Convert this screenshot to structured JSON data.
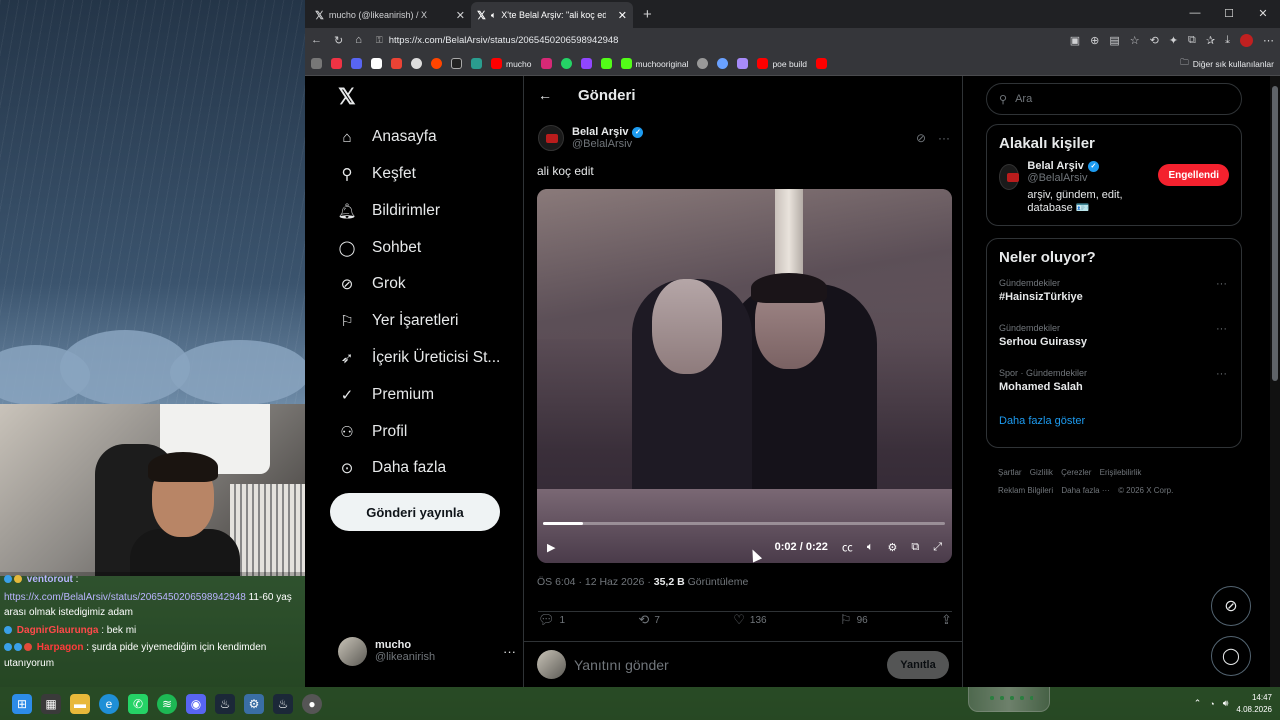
{
  "browser": {
    "tabs": [
      {
        "title": "mucho (@likeanirish) / X",
        "active": false
      },
      {
        "title": "X'te Belal Arşiv: \"ali koç edit h",
        "active": true
      }
    ],
    "url": "https://x.com/BelalArsiv/status/2065450206598942948",
    "bookmarks": [
      "mucho",
      "muchooriginal",
      "poe build"
    ],
    "other_bookmarks": "Diğer sık kullanılanlar"
  },
  "nav": {
    "items": [
      "Anasayfa",
      "Keşfet",
      "Bildirimler",
      "Sohbet",
      "Grok",
      "Yer İşaretleri",
      "İçerik Üreticisi St...",
      "Premium",
      "Profil",
      "Daha fazla"
    ],
    "post_button": "Gönderi yayınla",
    "account": {
      "name": "mucho",
      "handle": "@likeanirish"
    }
  },
  "main": {
    "header": "Gönderi",
    "author": {
      "name": "Belal Arşiv",
      "handle": "@BelalArsiv"
    },
    "text": "ali koç edit",
    "video": {
      "time": "0:02 / 0:22",
      "progress": 0.1
    },
    "meta": {
      "time": "ÖS 6:04 · 12 Haz 2026 · ",
      "views": "35,2 B",
      "views_label": " Görüntüleme"
    },
    "stats": {
      "replies": "1",
      "reposts": "7",
      "likes": "136",
      "bookmarks": "96"
    },
    "reply_placeholder": "Yanıtını gönder",
    "reply_button": "Yanıtla"
  },
  "right": {
    "search_placeholder": "Ara",
    "related_title": "Alakalı kişiler",
    "related": {
      "name": "Belal Arşiv",
      "handle": "@BelalArsiv",
      "bio": "arşiv, gündem, edit, database 🪪",
      "button": "Engellendi"
    },
    "trends_title": "Neler oluyor?",
    "trends": [
      {
        "category": "Gündemdekiler",
        "title": "#HainsizTürkiye"
      },
      {
        "category": "Gündemdekiler",
        "title": "Serhou Guirassy"
      },
      {
        "category": "Spor · Gündemdekiler",
        "title": "Mohamed Salah"
      }
    ],
    "show_more": "Daha fazla göster",
    "footer": [
      "Şartlar",
      "Gizlilik",
      "Çerezler",
      "Erişilebilirlik",
      "Reklam Bilgileri",
      "Daha fazla ···",
      "© 2026 X Corp."
    ]
  },
  "chat": [
    {
      "user": "ventorout",
      "text": ":"
    },
    {
      "user": "",
      "link": "https://x.com/BelalArsiv/status/2065450206598942948",
      "text": " 11-60 yaş arası olmak istedigimiz adam"
    },
    {
      "user": "DagnirGlaurunga",
      "text": ": bek mi"
    },
    {
      "user": "Harpagon",
      "text": ": şurda pide yiyemediğim için kendimden utanıyorum"
    }
  ],
  "clock": {
    "time": "14:47",
    "date": "4.08.2026"
  }
}
